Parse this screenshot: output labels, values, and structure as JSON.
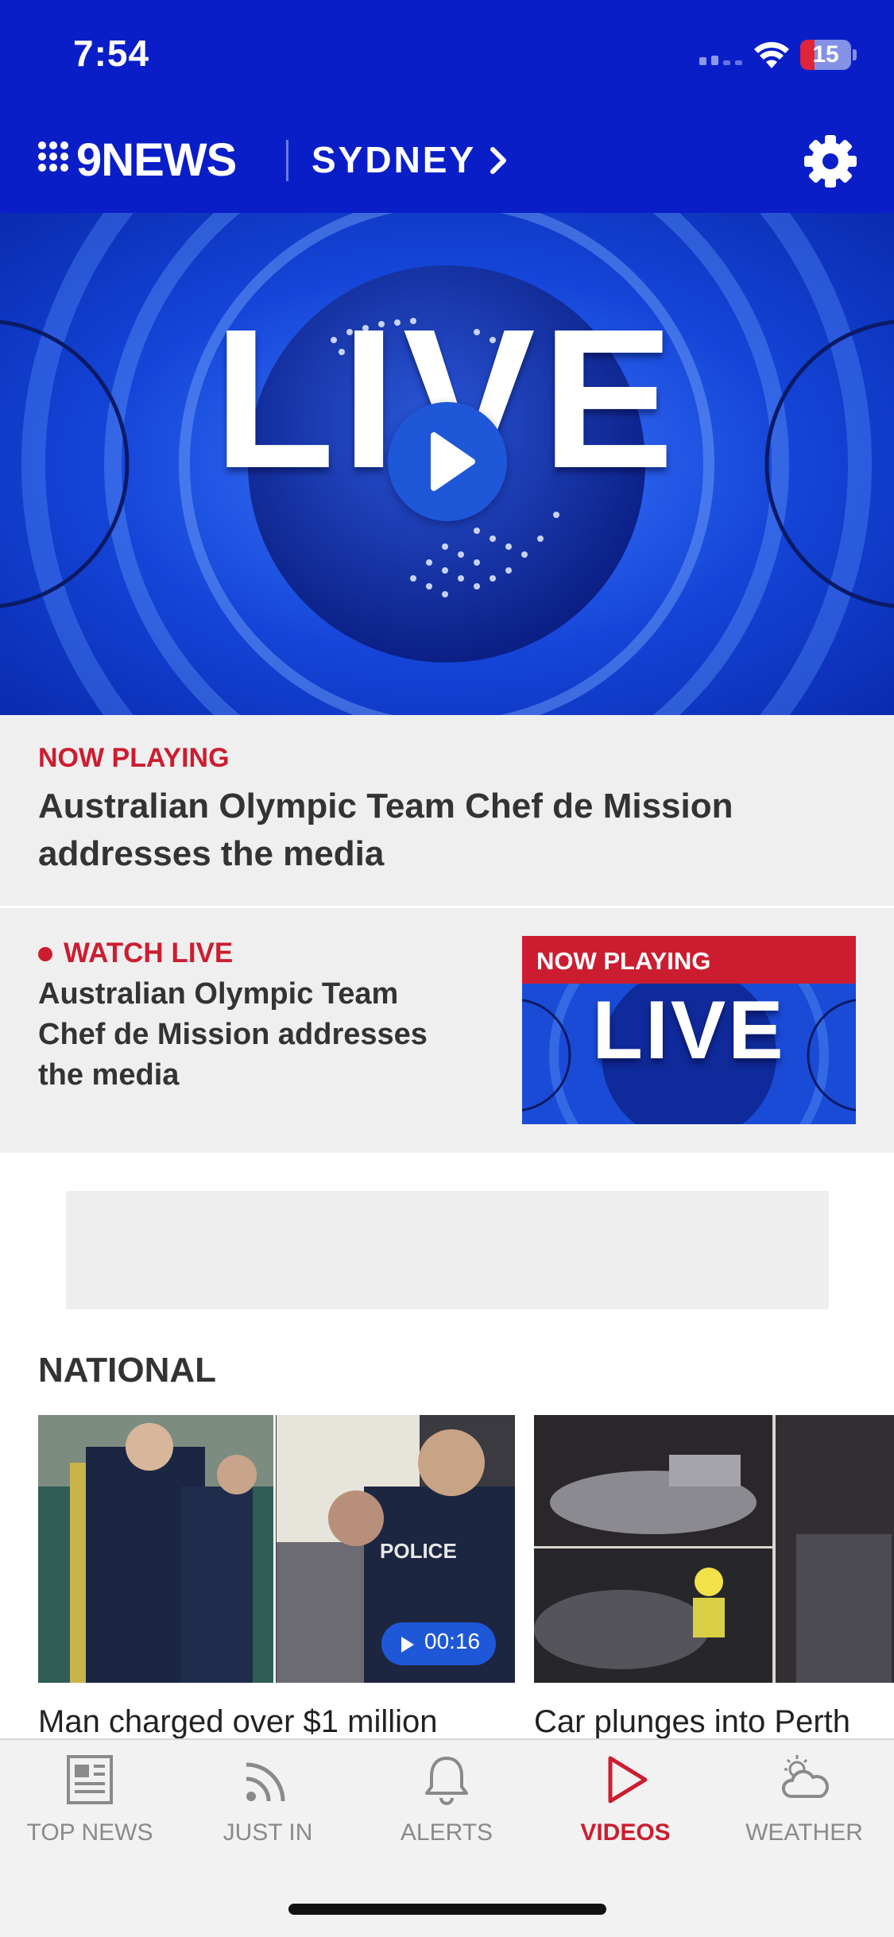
{
  "status_bar": {
    "time": "7:54",
    "battery": "15"
  },
  "header": {
    "logo": "9NEWS",
    "city": "SYDNEY"
  },
  "hero": {
    "live_text": "LIVE"
  },
  "now_playing": {
    "label": "NOW PLAYING",
    "title": "Australian Olympic Team Chef de Mission addresses the media"
  },
  "watch_live": {
    "label": "WATCH LIVE",
    "title_lines": [
      "Australian Olympic Team",
      "Chef de Mission addresses",
      "the media"
    ],
    "thumb_tag": "NOW PLAYING",
    "thumb_text": "LIVE"
  },
  "national": {
    "heading": "NATIONAL",
    "cards": [
      {
        "title": "Man charged over $1 million",
        "duration": "00:16",
        "image_badge": "POLICE"
      },
      {
        "title": "Car plunges into Perth"
      }
    ]
  },
  "tabbar": {
    "tabs": [
      {
        "label": "TOP NEWS",
        "icon": "newspaper-icon",
        "active": false
      },
      {
        "label": "JUST IN",
        "icon": "rss-icon",
        "active": false
      },
      {
        "label": "ALERTS",
        "icon": "bell-icon",
        "active": false
      },
      {
        "label": "VIDEOS",
        "icon": "play-icon",
        "active": true
      },
      {
        "label": "WEATHER",
        "icon": "sun-cloud-icon",
        "active": false
      }
    ]
  },
  "colors": {
    "brand_blue": "#0a1ec8",
    "accent_red": "#cc1d30",
    "play_blue": "#1f57d9"
  }
}
